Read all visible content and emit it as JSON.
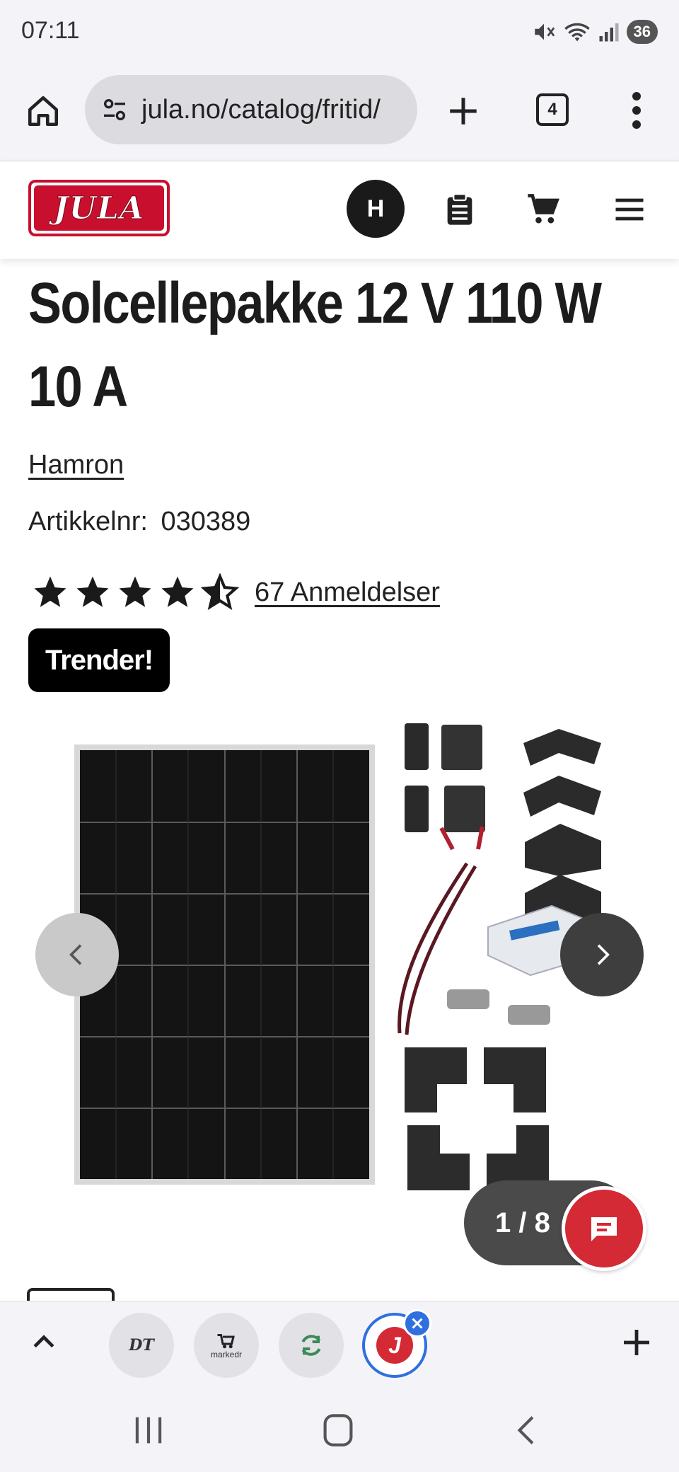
{
  "status_bar": {
    "time": "07:11",
    "battery": "36"
  },
  "browser": {
    "url": "jula.no/catalog/fritid/",
    "tab_count": "4"
  },
  "header": {
    "logo_text": "JULA",
    "avatar_initial": "H"
  },
  "product": {
    "title": "Solcellepakke 12 V 110 W 10 A",
    "brand": "Hamron",
    "article_label": "Artikkelnr:",
    "article_number": "030389",
    "rating": 4.5,
    "reviews_label": "67 Anmeldelser",
    "badge": "Trender!"
  },
  "gallery": {
    "counter": "1 / 8"
  },
  "tab_strip": {
    "tabs": [
      {
        "icon": "dt-news-icon",
        "label": "DT"
      },
      {
        "icon": "marketplace-icon",
        "label": "markedr"
      },
      {
        "icon": "refresh-app-icon",
        "label": ""
      },
      {
        "icon": "jula-app-icon",
        "label": "J"
      }
    ]
  },
  "colors": {
    "brand_red": "#c8102e",
    "chat_red": "#d42a35",
    "active_tab_blue": "#2f6fe0"
  }
}
